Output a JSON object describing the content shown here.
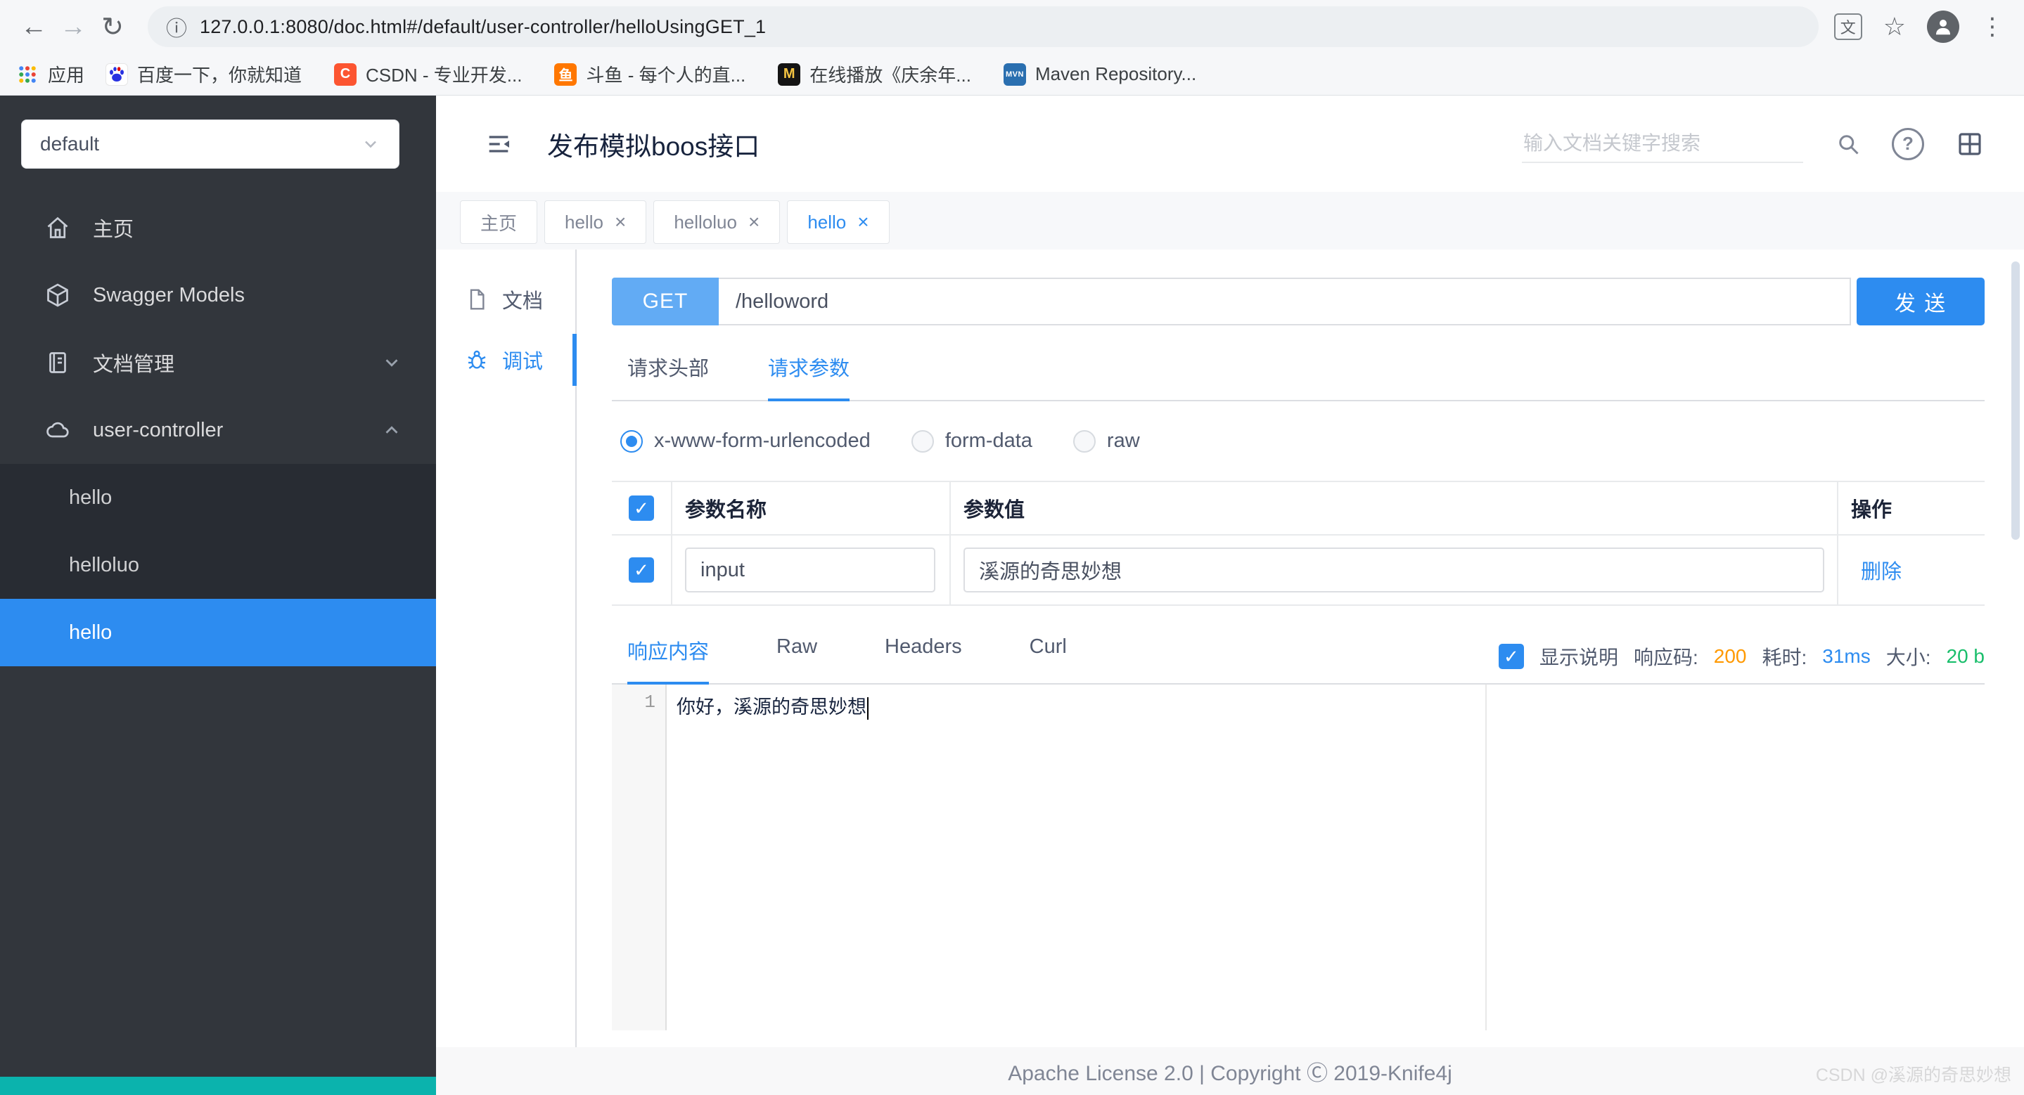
{
  "icons": {
    "back": "←",
    "forward": "→",
    "refresh": "↻",
    "info": "ⓘ",
    "translate": "文",
    "star": "☆",
    "menu_dots": "⋮",
    "close": "×",
    "check": "✓",
    "help": "?"
  },
  "browser": {
    "url": "127.0.0.1:8080/doc.html#/default/user-controller/helloUsingGET_1",
    "apps_label": "应用",
    "bookmarks": [
      {
        "label": "百度一下，你就知道",
        "icon": "baidu-favicon"
      },
      {
        "label": "CSDN - 专业开发...",
        "icon": "csdn-favicon",
        "glyph": "C"
      },
      {
        "label": "斗鱼 - 每个人的直...",
        "icon": "douyu-favicon",
        "glyph": "鱼"
      },
      {
        "label": "在线播放《庆余年...",
        "icon": "video-favicon",
        "glyph": "M"
      },
      {
        "label": "Maven Repository...",
        "icon": "maven-favicon",
        "glyph": "MVN"
      }
    ]
  },
  "sidebar": {
    "group_select": "default",
    "items": [
      {
        "label": "主页",
        "icon": "home-icon"
      },
      {
        "label": "Swagger Models",
        "icon": "models-icon"
      },
      {
        "label": "文档管理",
        "icon": "docs-icon",
        "chevron": "down"
      },
      {
        "label": "user-controller",
        "icon": "controller-icon",
        "chevron": "up"
      }
    ],
    "sub_items": [
      {
        "label": "hello",
        "active": false
      },
      {
        "label": "helloluo",
        "active": false
      },
      {
        "label": "hello",
        "active": true
      }
    ]
  },
  "header": {
    "title": "发布模拟boos接口",
    "search_placeholder": "输入文档关键字搜索"
  },
  "tabs": [
    {
      "label": "主页",
      "closable": false,
      "active": false
    },
    {
      "label": "hello",
      "closable": true,
      "active": false
    },
    {
      "label": "helloluo",
      "closable": true,
      "active": false
    },
    {
      "label": "hello",
      "closable": true,
      "active": true
    }
  ],
  "doc_nav": [
    {
      "label": "文档",
      "active": false
    },
    {
      "label": "调试",
      "active": true
    }
  ],
  "debug": {
    "method": "GET",
    "url": "/helloword",
    "send_label": "发 送",
    "request_tabs": [
      {
        "label": "请求头部",
        "active": false
      },
      {
        "label": "请求参数",
        "active": true
      }
    ],
    "body_types": [
      {
        "label": "x-www-form-urlencoded",
        "selected": true
      },
      {
        "label": "form-data",
        "selected": false
      },
      {
        "label": "raw",
        "selected": false
      }
    ],
    "params_table": {
      "headers": [
        "参数名称",
        "参数值",
        "操作"
      ],
      "rows": [
        {
          "checked": true,
          "name": "input",
          "value": "溪源的奇思妙想",
          "action": "删除"
        }
      ]
    },
    "response_tabs": [
      {
        "label": "响应内容",
        "active": true
      },
      {
        "label": "Raw",
        "active": false
      },
      {
        "label": "Headers",
        "active": false
      },
      {
        "label": "Curl",
        "active": false
      }
    ],
    "response_meta": {
      "show_desc_label": "显示说明",
      "code_label": "响应码:",
      "code_value": "200",
      "time_label": "耗时:",
      "time_value": "31ms",
      "size_label": "大小:",
      "size_value": "20 b"
    },
    "editor": {
      "line_number": "1",
      "content": "你好，溪源的奇思妙想"
    }
  },
  "footer": {
    "text": "Apache License 2.0 | Copyright Ⓒ 2019-Knife4j"
  },
  "watermark": "CSDN @溪源的奇思妙想"
}
